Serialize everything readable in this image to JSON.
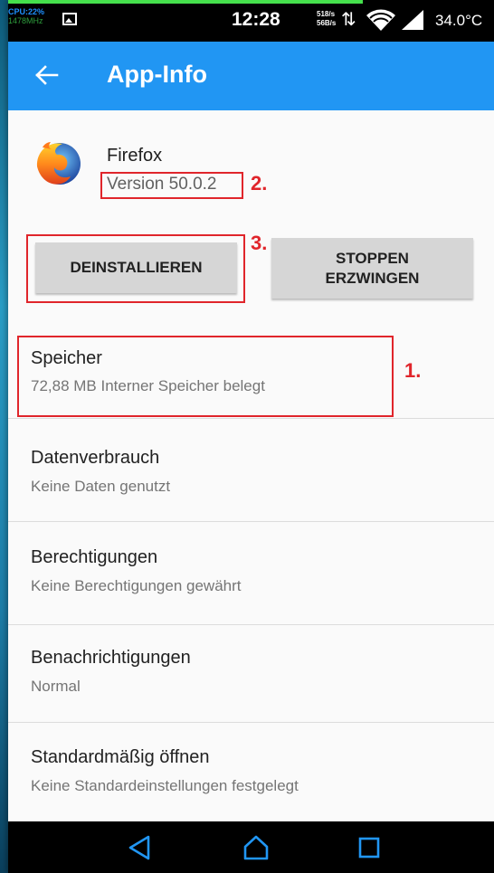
{
  "status_bar": {
    "cpu_line1": "CPU:22%",
    "cpu_line2": "1478MHz",
    "time": "12:28",
    "net_up": "518/s",
    "net_down": "56B/s",
    "temperature": "34.0°C",
    "progress_percent": 73
  },
  "appbar": {
    "title": "App-Info",
    "back_icon": "back-arrow-icon"
  },
  "app": {
    "name": "Firefox",
    "version": "Version 50.0.2",
    "icon": "firefox-icon"
  },
  "buttons": {
    "uninstall": "DEINSTALLIEREN",
    "force_stop_line1": "STOPPEN",
    "force_stop_line2": "ERZWINGEN"
  },
  "annotations": {
    "one": "1.",
    "two": "2.",
    "three": "3."
  },
  "settings": [
    {
      "title": "Speicher",
      "subtitle": "72,88 MB Interner Speicher belegt"
    },
    {
      "title": "Datenverbrauch",
      "subtitle": "Keine Daten genutzt"
    },
    {
      "title": "Berechtigungen",
      "subtitle": "Keine Berechtigungen gewährt"
    },
    {
      "title": "Benachrichtigungen",
      "subtitle": "Normal"
    },
    {
      "title": "Standardmäßig öffnen",
      "subtitle": "Keine Standardeinstellungen festgelegt"
    }
  ],
  "colors": {
    "appbar": "#2196f3",
    "annotation": "#e0252b",
    "button": "#d6d6d6"
  },
  "nav_icons": [
    "back-triangle-icon",
    "home-icon",
    "recents-icon"
  ]
}
